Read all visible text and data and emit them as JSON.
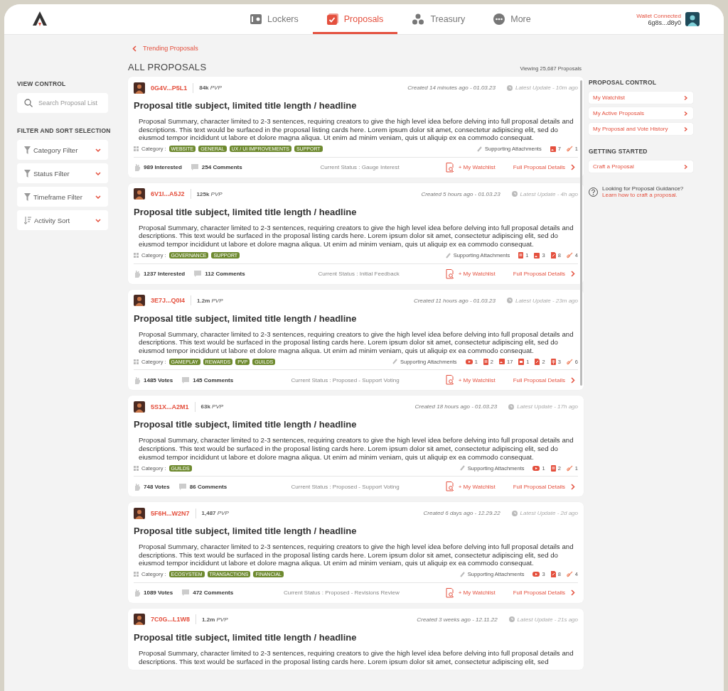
{
  "header": {
    "nav": [
      {
        "label": "Lockers",
        "selected": false
      },
      {
        "label": "Proposals",
        "selected": true
      },
      {
        "label": "Treasury",
        "selected": false
      },
      {
        "label": "More",
        "selected": false
      }
    ],
    "wallet": {
      "status": "Wallet Connected",
      "address": "6g8s...d8y0"
    }
  },
  "breadcrumb": "Trending Proposals",
  "list_title": "ALL PROPOSALS",
  "viewing": "Viewing 25,687 Proposals",
  "left": {
    "view_heading": "VIEW CONTROL",
    "search": {
      "placeholder": "Search Proposal List"
    },
    "filter_heading": "FILTER AND SORT SELECTION",
    "filters": [
      {
        "label": "Category Filter",
        "kind": "filter"
      },
      {
        "label": "Status Filter",
        "kind": "filter"
      },
      {
        "label": "Timeframe Filter",
        "kind": "filter"
      },
      {
        "label": "Activity Sort",
        "kind": "sort"
      }
    ]
  },
  "proposals": [
    {
      "author": "0G4V...P5L1",
      "pvp": "84k",
      "pvp_unit": "PVP",
      "created": "Created 14 minutes ago - 01.03.23",
      "updated": "Latest Update - 10m ago",
      "title": "Proposal title subject, limited title length / headline",
      "summary": "Proposal Summary, character limited to 2-3 sentences, requiring creators to give the high level idea before delving into full proposal details and descriptions. This text would be surfaced in the proposal listing cards here. Lorem ipsum dolor sit amet, consectetur adipiscing elit, sed do eiusmod tempor incididunt ut labore et dolore magna aliqua. Ut enim ad minim veniam, quis ut aliquip ex ea commodo consequat.",
      "category_label": "Category :",
      "tags": [
        "WEBSITE",
        "GENERAL",
        "UX / UI IMPROVEMENTS",
        "SUPPORT"
      ],
      "attachments_label": "Supporting Attachments",
      "attachments": [
        {
          "kind": "image",
          "count": "7"
        },
        {
          "kind": "link",
          "count": "1"
        }
      ],
      "engagement": "989 Interested",
      "comments": "254 Comments",
      "status": "Current Status : Gauge Interest",
      "watchlist": "+ My Watchlist",
      "details": "Full Proposal Details"
    },
    {
      "author": "6V1I...A5J2",
      "pvp": "125k",
      "pvp_unit": "PVP",
      "created": "Created 5 hours ago - 01.03.23",
      "updated": "Latest Update - 4h ago",
      "title": "Proposal title subject, limited title length / headline",
      "summary": "Proposal Summary, character limited to 2-3 sentences, requiring creators to give the high level idea before delving into full proposal details and descriptions. This text would be surfaced in the proposal listing cards here. Lorem ipsum dolor sit amet, consectetur adipiscing elit, sed do eiusmod tempor incididunt ut labore et dolore magna aliqua. Ut enim ad minim veniam, quis ut aliquip ex ea commodo consequat.",
      "category_label": "Category :",
      "tags": [
        "GOVERNANCE",
        "SUPPORT"
      ],
      "attachments_label": "Supporting Attachments",
      "attachments": [
        {
          "kind": "doc",
          "count": "1"
        },
        {
          "kind": "image",
          "count": "3"
        },
        {
          "kind": "pdf",
          "count": "8"
        },
        {
          "kind": "link",
          "count": "4"
        }
      ],
      "engagement": "1237 Interested",
      "comments": "112 Comments",
      "status": "Current Status : Initial Feedback",
      "watchlist": "+ My Watchlist",
      "details": "Full Proposal Details"
    },
    {
      "author": "3E7J...Q0I4",
      "pvp": "1.2m",
      "pvp_unit": "PVP",
      "created": "Created 11 hours ago - 01.03.23",
      "updated": "Latest Update - 23m ago",
      "title": "Proposal title subject, limited title length / headline",
      "summary": "Proposal Summary, character limited to 2-3 sentences, requiring creators to give the high level idea before delving into full proposal details and descriptions. This text would be surfaced in the proposal listing cards here. Lorem ipsum dolor sit amet, consectetur adipiscing elit, sed do eiusmod tempor incididunt ut labore et dolore magna aliqua. Ut enim ad minim veniam, quis ut aliquip ex ea commodo consequat.",
      "category_label": "Category :",
      "tags": [
        "GAMEPLAY",
        "REWARDS",
        "PVP",
        "GUILDS"
      ],
      "attachments_label": "Supporting Attachments",
      "attachments": [
        {
          "kind": "video",
          "count": "1"
        },
        {
          "kind": "doc",
          "count": "2"
        },
        {
          "kind": "image",
          "count": "17"
        },
        {
          "kind": "slide",
          "count": "1"
        },
        {
          "kind": "pdf",
          "count": "2"
        },
        {
          "kind": "sheet",
          "count": "3"
        },
        {
          "kind": "link",
          "count": "6"
        }
      ],
      "engagement": "1485 Votes",
      "comments": "145 Comments",
      "status": "Current Status : Proposed - Support Voting",
      "watchlist": "+ My Watchlist",
      "details": "Full Proposal Details"
    },
    {
      "author": "5S1X...A2M1",
      "pvp": "63k",
      "pvp_unit": "PVP",
      "created": "Created 18 hours ago - 01.03.23",
      "updated": "Latest Update - 17h ago",
      "title": "Proposal title subject, limited title length / headline",
      "summary": "Proposal Summary, character limited to 2-3 sentences, requiring creators to give the high level idea before delving into full proposal details and descriptions. This text would be surfaced in the proposal listing cards here. Lorem ipsum dolor sit amet, consectetur adipiscing elit, sed do eiusmod tempor incididunt ut labore et dolore magna aliqua. Ut enim ad minim veniam, quis ut aliquip ex ea commodo consequat.",
      "category_label": "Category :",
      "tags": [
        "GUILDS"
      ],
      "attachments_label": "Supporting Attachments",
      "attachments": [
        {
          "kind": "video",
          "count": "1"
        },
        {
          "kind": "doc",
          "count": "2"
        },
        {
          "kind": "link",
          "count": "1"
        }
      ],
      "engagement": "748 Votes",
      "comments": "86 Comments",
      "status": "Current Status : Proposed - Support Voting",
      "watchlist": "+ My Watchlist",
      "details": "Full Proposal Details"
    },
    {
      "author": "5F6H...W2N7",
      "pvp": "1,487",
      "pvp_unit": "PVP",
      "created": "Created 6 days ago - 12.29.22",
      "updated": "Latest Update - 2d ago",
      "title": "Proposal title subject, limited title length / headline",
      "summary": "Proposal Summary, character limited to 2-3 sentences, requiring creators to give the high level idea before delving into full proposal details and descriptions. This text would be surfaced in the proposal listing cards here. Lorem ipsum dolor sit amet, consectetur adipiscing elit, sed do eiusmod tempor incididunt ut labore et dolore magna aliqua. Ut enim ad minim veniam, quis ut aliquip ex ea commodo consequat.",
      "category_label": "Category :",
      "tags": [
        "ECOSYSTEM",
        "TRANSACTIONS",
        "FINANCIAL"
      ],
      "attachments_label": "Supporting Attachments",
      "attachments": [
        {
          "kind": "video",
          "count": "3"
        },
        {
          "kind": "pdf",
          "count": "8"
        },
        {
          "kind": "link",
          "count": "4"
        }
      ],
      "engagement": "1089 Votes",
      "comments": "472 Comments",
      "status": "Current Status : Proposed - Revisions Review",
      "watchlist": "+ My Watchlist",
      "details": "Full Proposal Details"
    },
    {
      "author": "7C0G...L1W8",
      "pvp": "1.2m",
      "pvp_unit": "PVP",
      "created": "Created 3 weeks ago - 12.11.22",
      "updated": "Latest Update - 21s ago",
      "title": "Proposal title subject, limited title length / headline",
      "summary": "Proposal Summary, character limited to 2-3 sentences, requiring creators to give the high level idea before delving into full proposal details and descriptions. This text would be surfaced in the proposal listing cards here. Lorem ipsum dolor sit amet, consectetur adipiscing elit, sed"
    }
  ],
  "right": {
    "control_heading": "PROPOSAL CONTROL",
    "control_links": [
      "My Watchlist",
      "My Active Proposals",
      "My Proposal and Vote History"
    ],
    "started_heading": "GETTING STARTED",
    "started_links": [
      "Craft a Proposal"
    ],
    "help_text": "Looking for Proposal Guidance?",
    "help_link": "Learn how to craft a proposal."
  }
}
